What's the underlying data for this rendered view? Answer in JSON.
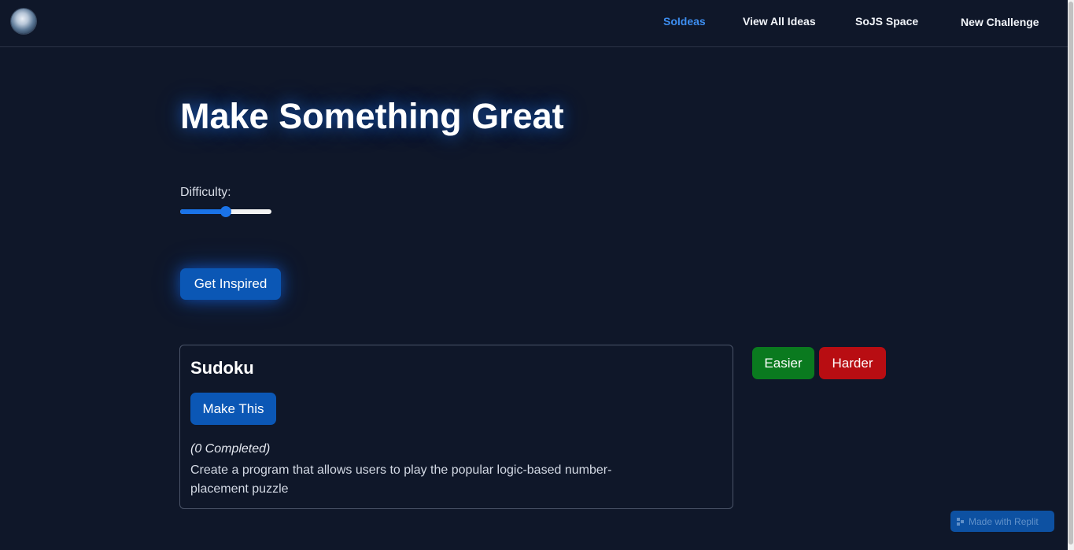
{
  "nav": {
    "logo_icon": "moon-icon",
    "links": [
      {
        "label": "SoIdeas",
        "active": true
      },
      {
        "label": "View All Ideas",
        "active": false
      },
      {
        "label": "SoJS Space",
        "active": false
      },
      {
        "label": "New Challenge",
        "active": false
      }
    ]
  },
  "hero": {
    "title": "Make Something Great"
  },
  "difficulty": {
    "label": "Difficulty:",
    "value_fraction": 0.5
  },
  "inspire": {
    "button_label": "Get Inspired"
  },
  "idea_card": {
    "title": "Sudoku",
    "make_button_label": "Make This",
    "completed_text": "(0 Completed)",
    "description": "Create a program that allows users to play the popular logic-based number-placement puzzle"
  },
  "adjust": {
    "easier_label": "Easier",
    "harder_label": "Harder"
  },
  "badge": {
    "label": "Made with Replit",
    "icon": "replit-icon"
  },
  "colors": {
    "background": "#0f1729",
    "accent": "#0b57b5",
    "active_link": "#3d8ef0",
    "easier": "#0a7a1f",
    "harder": "#b80d12"
  }
}
